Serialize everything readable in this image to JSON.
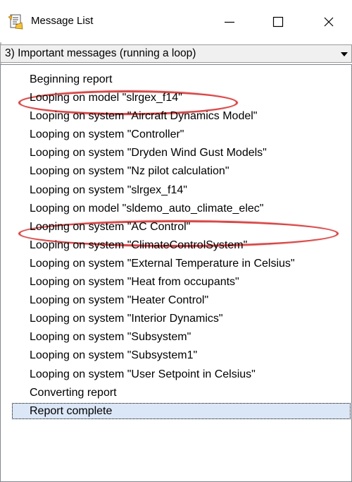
{
  "window": {
    "title": "Message List",
    "icon": "message-list-icon",
    "controls": {
      "minimize": "minimize-icon",
      "maximize": "maximize-icon",
      "close": "close-icon"
    }
  },
  "filter": {
    "selected": "3) Important messages (running a loop)"
  },
  "messages": [
    "Beginning report",
    "Looping on model \"slrgex_f14\"",
    "Looping on system \"Aircraft Dynamics Model\"",
    "Looping on system \"Controller\"",
    "Looping on system \"Dryden Wind Gust Models\"",
    "Looping on system \"Nz pilot calculation\"",
    "Looping on system \"slrgex_f14\"",
    "Looping on model \"sldemo_auto_climate_elec\"",
    "Looping on system \"AC Control\"",
    "Looping on system \"ClimateControlSystem\"",
    "Looping on system \"External Temperature in Celsius\"",
    "Looping on system \"Heat from occupants\"",
    "Looping on system \"Heater Control\"",
    "Looping on system \"Interior Dynamics\"",
    "Looping on system \"Subsystem\"",
    "Looping on system \"Subsystem1\"",
    "Looping on system \"User Setpoint in Celsius\"",
    "Converting report",
    "Report complete"
  ],
  "colors": {
    "highlight": "#d84848",
    "selection": "#dbe7f7"
  }
}
